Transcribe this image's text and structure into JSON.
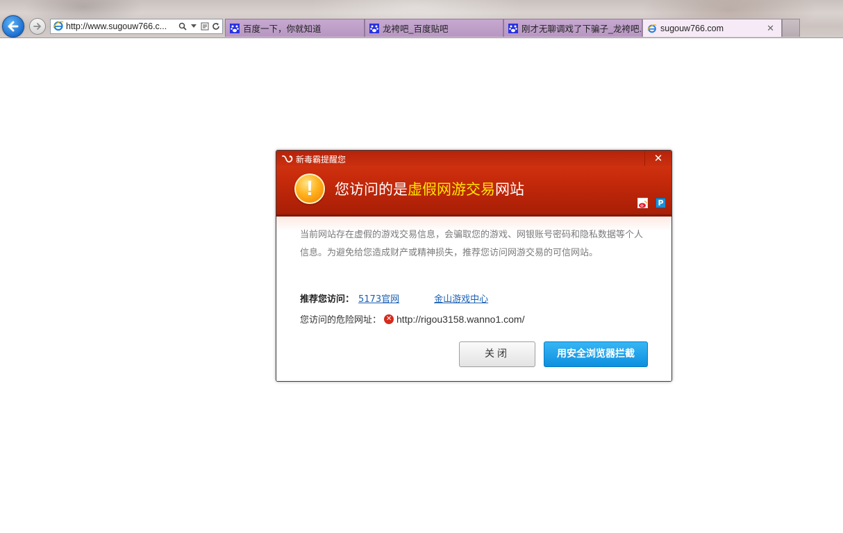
{
  "browser": {
    "address_url": "http://www.sugouw766.c...",
    "tabs": [
      {
        "label": "百度一下，你就知道",
        "icon": "baidu-paw-icon",
        "active": false
      },
      {
        "label": "龙袴吧_百度贴吧",
        "icon": "baidu-paw-icon",
        "active": false
      },
      {
        "label": "刚才无聊调戏了下骗子_龙袴吧...",
        "icon": "baidu-paw-icon",
        "active": false
      },
      {
        "label": "sugouw766.com",
        "icon": "ie-icon",
        "active": true
      }
    ],
    "tab_close_glyph": "✕"
  },
  "dialog": {
    "brand": "新毒霸提醒您",
    "close_glyph": "✕",
    "title_prefix": "您访问的是",
    "title_highlight": "虚假网游交易",
    "title_suffix": "网站",
    "message": "当前网站存在虚假的游戏交易信息，会骗取您的游戏、网银账号密码和隐私数据等个人信息。为避免给您造成财产或精神损失，推荐您访问网游交易的可信网站。",
    "recommend_label": "推荐您访问：",
    "recommend_links": [
      "5173官网",
      "金山游戏中心"
    ],
    "danger_label": "您访问的危险网址：",
    "danger_url": "http://rigou3158.wanno1.com/",
    "close_button": "关闭",
    "block_button": "用安全浏览器拦截"
  },
  "colors": {
    "header_red": "#c62a0b",
    "highlight_yellow": "#ffe600",
    "link_blue": "#1a5fb4",
    "primary_button_blue": "#0d8fde"
  }
}
